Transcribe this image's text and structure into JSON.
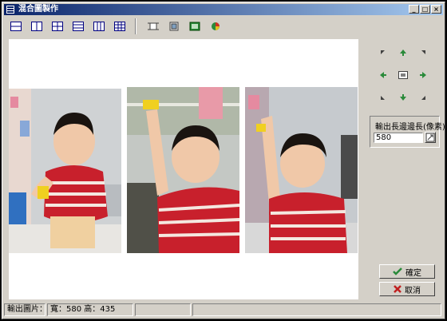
{
  "window": {
    "title": "混合圖製作",
    "min": "_",
    "max": "□",
    "close": "×"
  },
  "toolbar": {
    "tools": [
      {
        "icon": "layout-2rows-icon"
      },
      {
        "icon": "layout-2cols-icon"
      },
      {
        "icon": "layout-grid-icon"
      },
      {
        "icon": "layout-3rows-icon"
      },
      {
        "icon": "layout-3cols-icon"
      },
      {
        "icon": "layout-3x3-icon"
      },
      {
        "icon": "border-icon"
      },
      {
        "icon": "resize-icon"
      },
      {
        "icon": "fit-icon"
      },
      {
        "icon": "color-icon"
      }
    ]
  },
  "side": {
    "size_label": "輸出長邊邊長(像素)",
    "size_value": "580",
    "ok": "確定",
    "cancel": "取消"
  },
  "status": {
    "label": "輸出圖片：",
    "dims": "寬：580 高：435"
  },
  "colors": {
    "titlebar": "#0a246a",
    "shirt": "#c8202c",
    "background": "#d4d0c8"
  }
}
